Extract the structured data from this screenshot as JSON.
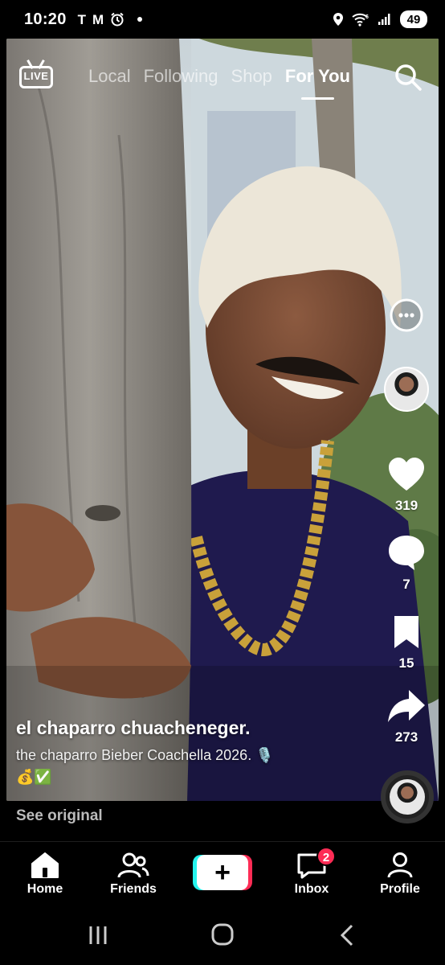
{
  "status_bar": {
    "time": "10:20",
    "notif_icons": [
      "T",
      "M"
    ],
    "battery": "49",
    "signal_tag": "6"
  },
  "top_nav": {
    "live_label": "LIVE",
    "tabs": [
      {
        "label": "Local",
        "active": false
      },
      {
        "label": "Following",
        "active": false
      },
      {
        "label": "Shop",
        "active": false
      },
      {
        "label": "For You",
        "active": true
      }
    ]
  },
  "rail": {
    "likes": "319",
    "comments": "7",
    "saves": "15",
    "shares": "273"
  },
  "caption": {
    "author": "el chaparro chuacheneger.",
    "description": "the chaparro Bieber Coachella 2026. 🎙️",
    "emoji": "💰✅"
  },
  "see_original": "See original",
  "bottom_nav": {
    "home": "Home",
    "friends": "Friends",
    "inbox": "Inbox",
    "inbox_badge": "2",
    "profile": "Profile",
    "create_symbol": "+"
  },
  "colors": {
    "accent_red": "#fe2c55",
    "accent_cyan": "#25f4ee"
  }
}
